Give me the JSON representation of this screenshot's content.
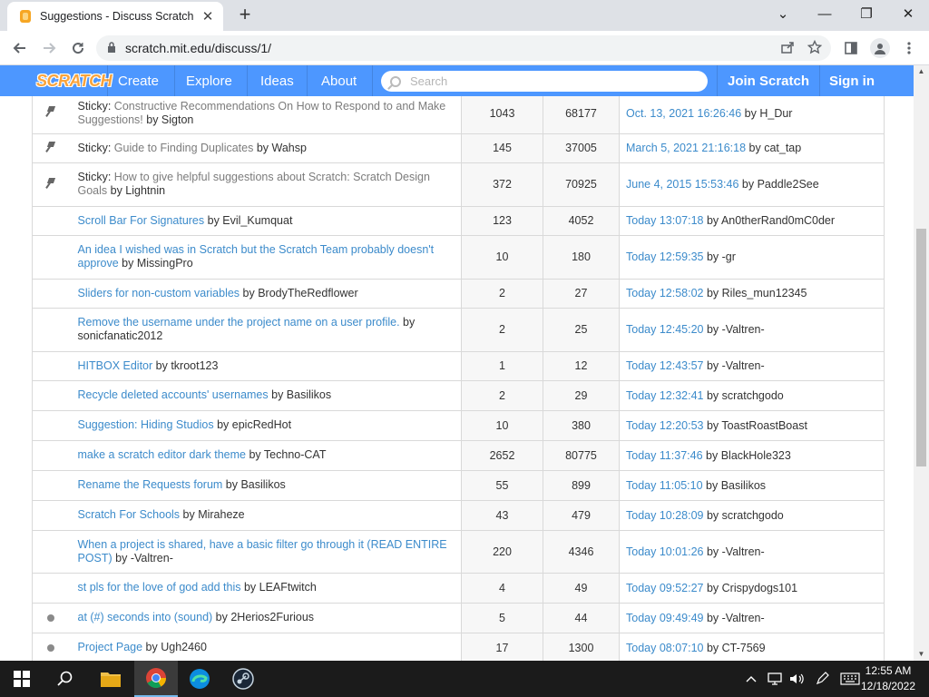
{
  "browser": {
    "tab_title": "Suggestions - Discuss Scratch",
    "tab_close": "✕",
    "new_tab": "+",
    "url": "scratch.mit.edu/discuss/1/",
    "win_minimize": "—",
    "win_restore": "❐",
    "win_close": "✕",
    "win_menu": "⌄"
  },
  "scratch_nav": {
    "logo": "SCRATCH",
    "links": [
      "Create",
      "Explore",
      "Ideas",
      "About"
    ],
    "search_placeholder": "Search",
    "join": "Join Scratch",
    "signin": "Sign in"
  },
  "topics": [
    {
      "icon": "pin",
      "prefix": "Sticky: ",
      "title": "Constructive Recommendations On How to Respond to and Make Suggestions!",
      "by": " by Sigton",
      "replies": "1043",
      "views": "68177",
      "last_date": "Oct. 13, 2021 16:26:46",
      "last_by": " by H_Dur"
    },
    {
      "icon": "pin",
      "prefix": "Sticky: ",
      "title": "Guide to Finding Duplicates",
      "by": " by Wahsp",
      "replies": "145",
      "views": "37005",
      "last_date": "March 5, 2021 21:16:18",
      "last_by": " by cat_tap"
    },
    {
      "icon": "pin",
      "prefix": "Sticky: ",
      "title": "How to give helpful suggestions about Scratch: Scratch Design Goals",
      "by": " by Lightnin",
      "replies": "372",
      "views": "70925",
      "last_date": "June 4, 2015 15:53:46",
      "last_by": " by Paddle2See"
    },
    {
      "icon": "none",
      "prefix": "",
      "title": "Scroll Bar For Signatures",
      "by": " by Evil_Kumquat",
      "replies": "123",
      "views": "4052",
      "last_date": "Today 13:07:18",
      "last_by": " by An0therRand0mC0der"
    },
    {
      "icon": "none",
      "prefix": "",
      "title": "An idea I wished was in Scratch but the Scratch Team probably doesn't approve",
      "by": " by MissingPro",
      "replies": "10",
      "views": "180",
      "last_date": "Today 12:59:35",
      "last_by": " by -gr"
    },
    {
      "icon": "none",
      "prefix": "",
      "title": "Sliders for non-custom variables",
      "by": " by BrodyTheRedflower",
      "replies": "2",
      "views": "27",
      "last_date": "Today 12:58:02",
      "last_by": " by Riles_mun12345"
    },
    {
      "icon": "none",
      "prefix": "",
      "title": "Remove the username under the project name on a user profile.",
      "by": " by sonicfanatic2012",
      "replies": "2",
      "views": "25",
      "last_date": "Today 12:45:20",
      "last_by": " by -Valtren-"
    },
    {
      "icon": "none",
      "prefix": "",
      "title": "HITBOX Editor",
      "by": " by tkroot123",
      "replies": "1",
      "views": "12",
      "last_date": "Today 12:43:57",
      "last_by": " by -Valtren-"
    },
    {
      "icon": "none",
      "prefix": "",
      "title": "Recycle deleted accounts' usernames",
      "by": " by Basilikos",
      "replies": "2",
      "views": "29",
      "last_date": "Today 12:32:41",
      "last_by": " by scratchgodo"
    },
    {
      "icon": "none",
      "prefix": "",
      "title": "Suggestion: Hiding Studios",
      "by": " by epicRedHot",
      "replies": "10",
      "views": "380",
      "last_date": "Today 12:20:53",
      "last_by": " by ToastRoastBoast"
    },
    {
      "icon": "none",
      "prefix": "",
      "title": "make a scratch editor dark theme",
      "by": " by Techno-CAT",
      "replies": "2652",
      "views": "80775",
      "last_date": "Today 11:37:46",
      "last_by": " by BlackHole323"
    },
    {
      "icon": "none",
      "prefix": "",
      "title": "Rename the Requests forum",
      "by": " by Basilikos",
      "replies": "55",
      "views": "899",
      "last_date": "Today 11:05:10",
      "last_by": " by Basilikos"
    },
    {
      "icon": "none",
      "prefix": "",
      "title": "Scratch For Schools",
      "by": " by Miraheze",
      "replies": "43",
      "views": "479",
      "last_date": "Today 10:28:09",
      "last_by": " by scratchgodo"
    },
    {
      "icon": "none",
      "prefix": "",
      "title": "When a project is shared, have a basic filter go through it (READ ENTIRE POST)",
      "by": " by -Valtren-",
      "replies": "220",
      "views": "4346",
      "last_date": "Today 10:01:26",
      "last_by": " by -Valtren-"
    },
    {
      "icon": "none",
      "prefix": "",
      "title": "st pls for the love of god add this",
      "by": " by LEAFtwitch",
      "replies": "4",
      "views": "49",
      "last_date": "Today 09:52:27",
      "last_by": " by Crispydogs101"
    },
    {
      "icon": "dot",
      "prefix": "",
      "title": "at (#) seconds into (sound)",
      "by": " by 2Herios2Furious",
      "replies": "5",
      "views": "44",
      "last_date": "Today 09:49:49",
      "last_by": " by -Valtren-"
    },
    {
      "icon": "dot",
      "prefix": "",
      "title": "Project Page",
      "by": " by Ugh2460",
      "replies": "17",
      "views": "1300",
      "last_date": "Today 08:07:10",
      "last_by": " by CT-7569"
    }
  ],
  "taskbar": {
    "time": "12:55 AM",
    "date": "12/18/2022"
  },
  "colors": {
    "scratch_blue": "#4d97ff",
    "link_blue": "#3c8bcb",
    "logo_orange": "#f9a33b"
  }
}
